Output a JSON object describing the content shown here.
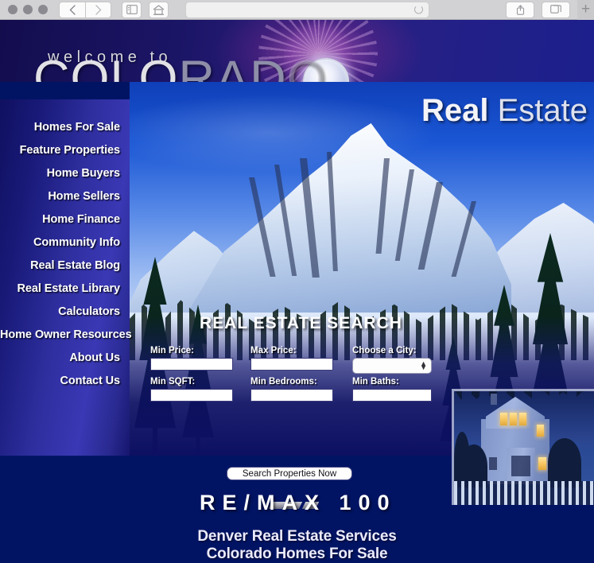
{
  "browser": {
    "back_icon": "chevron-left-icon",
    "forward_icon": "chevron-right-icon",
    "sidebar_icon": "sidebar-icon",
    "home_icon": "home-icon",
    "share_icon": "share-icon",
    "tabs_icon": "tabs-icon",
    "new_tab_label": "+",
    "address_value": "",
    "address_placeholder": "",
    "spinner_icon": "loading-spinner-icon"
  },
  "masthead": {
    "welcome_text": "welcome to",
    "title_part1": "COLO",
    "title_part2": "RAD",
    "title_part3": "O",
    "sun_icon": "sun-orb-icon"
  },
  "hero": {
    "real_bold": "Real",
    "estate_light": "Estate",
    "mountain_photo": "snowy-mountain-photo",
    "house_photo": "victorian-house-at-dusk-photo"
  },
  "nav": {
    "items": [
      {
        "label": "Homes For Sale"
      },
      {
        "label": "Feature Properties"
      },
      {
        "label": "Home Buyers"
      },
      {
        "label": "Home Sellers"
      },
      {
        "label": "Home Finance"
      },
      {
        "label": "Community Info"
      },
      {
        "label": "Real Estate Blog"
      },
      {
        "label": "Real Estate Library"
      },
      {
        "label": "Calculators"
      },
      {
        "label": "Home Owner Resources"
      },
      {
        "label": "About Us"
      },
      {
        "label": "Contact Us"
      }
    ]
  },
  "search": {
    "title": "REAL ESTATE SEARCH",
    "fields": [
      {
        "label": "Min Price:",
        "value": "",
        "type": "text"
      },
      {
        "label": "Max Price:",
        "value": "",
        "type": "text"
      },
      {
        "label": "Choose a City:",
        "value": "",
        "type": "select"
      },
      {
        "label": "Min SQFT:",
        "value": "",
        "type": "text"
      },
      {
        "label": "Min Bedrooms:",
        "value": "",
        "type": "text"
      },
      {
        "label": "Min Baths:",
        "value": "",
        "type": "text"
      }
    ],
    "submit_label": "Search Properties Now",
    "brand": "RE/MAX 100"
  },
  "footer": {
    "divider_icon": "triple-slash-divider-icon",
    "line1": "Denver Real Estate Services",
    "line2": "Colorado Homes For Sale"
  },
  "colors": {
    "page_bg": "#011464",
    "nav_blue": "#2f2fa0",
    "accent_white": "#ffffff",
    "masthead_purple": "#c460bc"
  }
}
